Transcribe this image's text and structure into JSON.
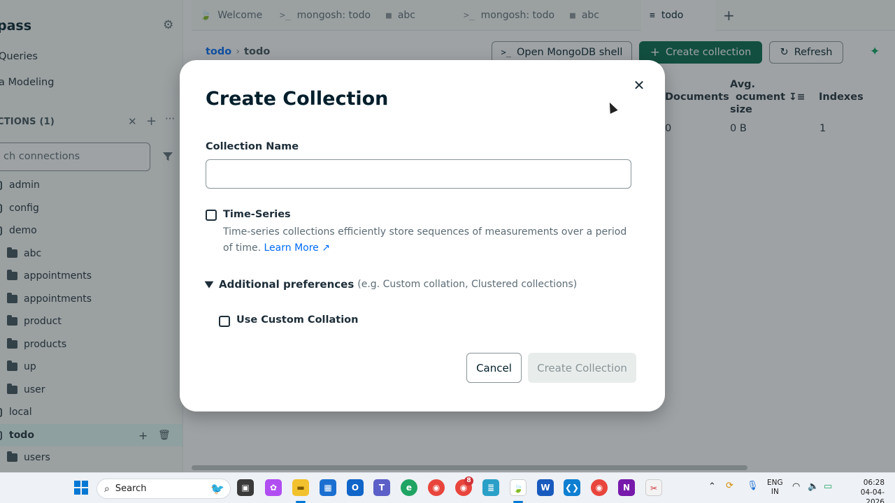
{
  "sidebar": {
    "brand": "pass",
    "nav": [
      "Queries",
      "a Modeling"
    ],
    "connections_header": "CTIONS (1)",
    "search_placeholder": "ch connections",
    "tree": [
      {
        "label": "admin",
        "kind": "db"
      },
      {
        "label": "config",
        "kind": "db"
      },
      {
        "label": "demo",
        "kind": "db"
      },
      {
        "label": "abc",
        "kind": "coll"
      },
      {
        "label": "appointments",
        "kind": "coll"
      },
      {
        "label": "appointments",
        "kind": "coll"
      },
      {
        "label": "product",
        "kind": "coll"
      },
      {
        "label": "products",
        "kind": "coll"
      },
      {
        "label": "up",
        "kind": "coll"
      },
      {
        "label": "user",
        "kind": "coll"
      },
      {
        "label": "local",
        "kind": "db"
      },
      {
        "label": "todo",
        "kind": "db",
        "active": true
      },
      {
        "label": "users",
        "kind": "coll"
      }
    ]
  },
  "tabs": [
    {
      "label": "Welcome",
      "icon": "leaf-icon"
    },
    {
      "label": "mongosh: todo",
      "icon": "shell-icon"
    },
    {
      "label": "abc",
      "icon": "folder-icon"
    },
    {
      "label": "mongosh: todo",
      "icon": "shell-icon"
    },
    {
      "label": "abc",
      "icon": "folder-icon"
    },
    {
      "label": "todo",
      "icon": "database-icon",
      "active": true
    }
  ],
  "toolbar": {
    "crumb_db": "todo",
    "crumb_current": "todo",
    "open_shell": "Open MongoDB shell",
    "create_collection": "Create collection",
    "refresh": "Refresh"
  },
  "table": {
    "headers": [
      "Documents",
      "Avg.",
      "ocument",
      "size",
      "Indexes"
    ],
    "row": [
      "0",
      "0 B",
      "1"
    ]
  },
  "modal": {
    "title": "Create Collection",
    "name_label": "Collection Name",
    "name_value": "",
    "timeseries_label": "Time-Series",
    "timeseries_desc": "Time-series collections efficiently store sequences of measurements over a period of time.",
    "learn_more": "Learn More",
    "additional_title": "Additional preferences",
    "additional_hint": "(e.g. Custom collation, Clustered collections)",
    "custom_collation_label": "Use Custom Collation",
    "cancel": "Cancel",
    "create": "Create Collection"
  },
  "taskbar": {
    "search": "Search",
    "lang_line1": "ENG",
    "lang_line2": "IN",
    "time": "06:28",
    "date": "04-04-2026",
    "badge": "8"
  },
  "colors": {
    "primary_green": "#00684a",
    "link_blue": "#016bf8",
    "accent_green": "#00a35c"
  }
}
